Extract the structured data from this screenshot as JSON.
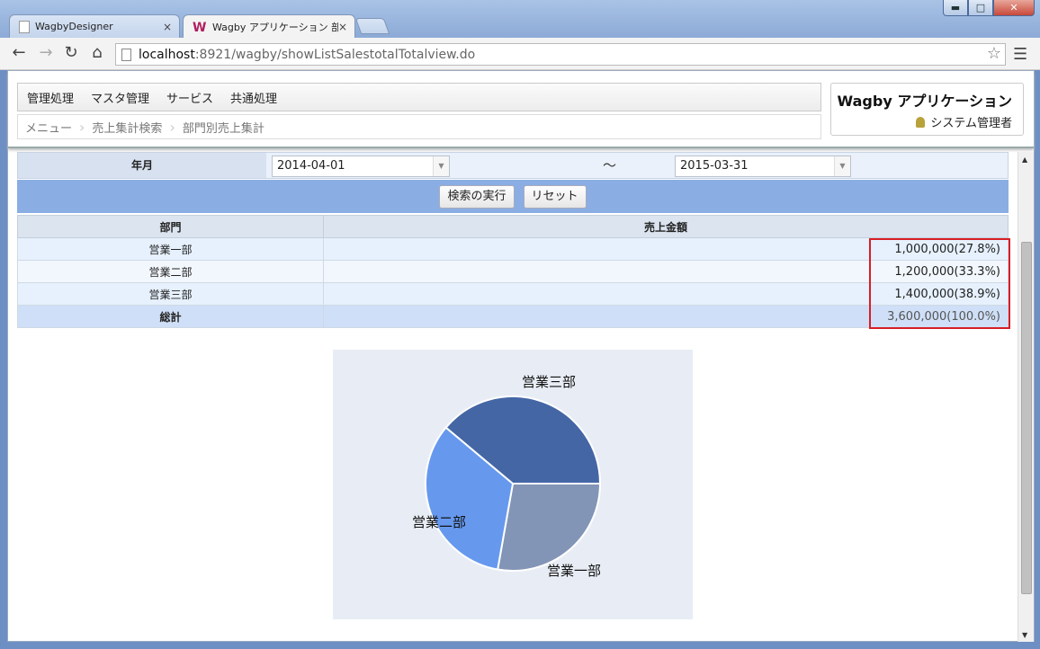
{
  "browser": {
    "tabs": [
      {
        "title": "WagbyDesigner",
        "close": "×"
      },
      {
        "title": "Wagby アプリケーション 部門別",
        "close": "×"
      }
    ],
    "tab_icon_letter": "W",
    "address_host": "localhost",
    "address_path": ":8921/wagby/showListSalestotalTotalview.do",
    "window_buttons": {
      "minimize": "▬",
      "maximize": "□",
      "close": "✕"
    }
  },
  "header": {
    "menu": [
      "管理処理",
      "マスタ管理",
      "サービス",
      "共通処理"
    ],
    "breadcrumb": [
      "メニュー",
      "売上集計検索",
      "部門別売上集計"
    ],
    "app_name": "Wagby アプリケーション",
    "user": "システム管理者"
  },
  "search": {
    "label": "年月",
    "from": "2014-04-01",
    "separator": "～",
    "to": "2015-03-31",
    "run_button": "検索の実行",
    "reset_button": "リセット"
  },
  "table": {
    "headers": [
      "部門",
      "売上金額"
    ],
    "rows": [
      {
        "dept": "営業一部",
        "amount": "1,000,000(27.8%)"
      },
      {
        "dept": "営業二部",
        "amount": "1,200,000(33.3%)"
      },
      {
        "dept": "営業三部",
        "amount": "1,400,000(38.9%)"
      }
    ],
    "total": {
      "dept": "総計",
      "amount": "3,600,000(100.0%)"
    }
  },
  "colors": {
    "highlight": "#d81e25",
    "accent": "#8aaee3"
  },
  "chart_data": {
    "type": "pie",
    "slices": [
      {
        "label": "営業一部",
        "value": 1000000,
        "color": "#8395b6"
      },
      {
        "label": "営業二部",
        "value": 1200000,
        "color": "#6699ee"
      },
      {
        "label": "営業三部",
        "value": 1400000,
        "color": "#4466a5"
      }
    ]
  }
}
